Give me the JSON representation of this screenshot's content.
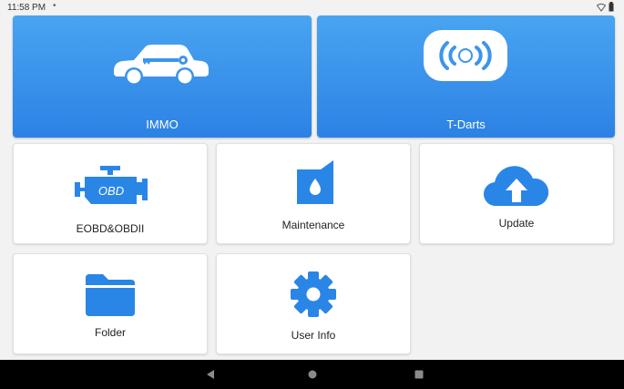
{
  "status_bar": {
    "time": "11:58 PM",
    "dot": "•",
    "icons": [
      "wifi-icon",
      "battery-icon"
    ]
  },
  "tiles": {
    "immo": {
      "label": "IMMO",
      "icon": "car-key-icon"
    },
    "tdarts": {
      "label": "T-Darts",
      "icon": "transponder-icon"
    },
    "obd": {
      "label": "EOBD&OBDII",
      "icon": "engine-icon",
      "icon_text": "OBD"
    },
    "maintenance": {
      "label": "Maintenance",
      "icon": "oil-can-icon"
    },
    "update": {
      "label": "Update",
      "icon": "cloud-upload-icon"
    },
    "folder": {
      "label": "Folder",
      "icon": "folder-icon"
    },
    "user_info": {
      "label": "User Info",
      "icon": "gear-icon"
    }
  },
  "nav_bar": {
    "buttons": [
      "back-button",
      "home-button",
      "recents-button"
    ]
  },
  "colors": {
    "accent_blue": "#2c82e4",
    "accent_blue_light": "#49a4f1",
    "icon_blue": "#2a86e6",
    "background": "#f2f2f2",
    "nav_bar": "#000000"
  }
}
